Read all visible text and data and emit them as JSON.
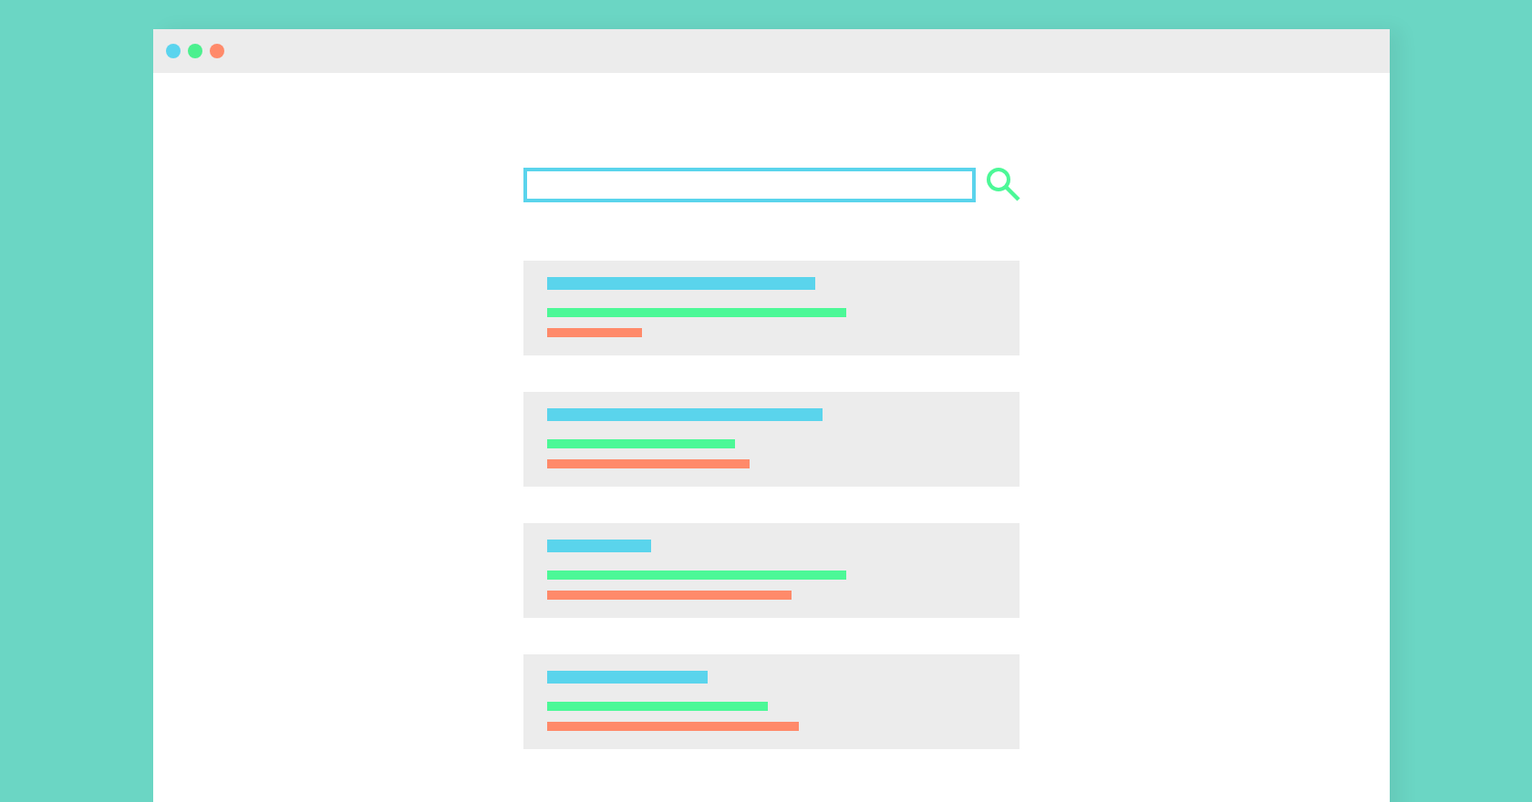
{
  "window": {
    "controls": [
      {
        "color": "#5ad4ee"
      },
      {
        "color": "#4cf08e"
      },
      {
        "color": "#ff8a6a"
      }
    ]
  },
  "results": [
    {
      "lines": [
        {
          "kind": "title"
        },
        {
          "kind": "link"
        },
        {
          "kind": "snippet"
        }
      ]
    },
    {
      "lines": [
        {
          "kind": "title"
        },
        {
          "kind": "link"
        },
        {
          "kind": "snippet"
        }
      ]
    },
    {
      "lines": [
        {
          "kind": "title"
        },
        {
          "kind": "link"
        },
        {
          "kind": "snippet"
        }
      ]
    },
    {
      "lines": [
        {
          "kind": "title"
        },
        {
          "kind": "link"
        },
        {
          "kind": "snippet"
        }
      ]
    }
  ]
}
